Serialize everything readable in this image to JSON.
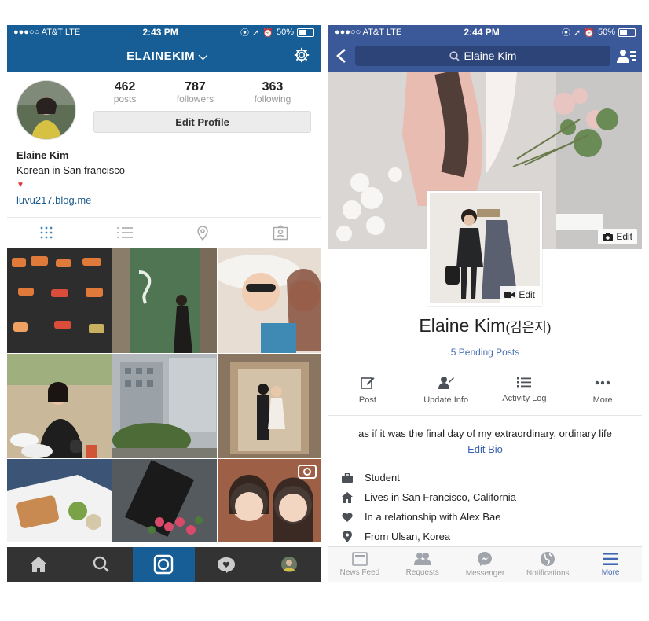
{
  "instagram": {
    "status": {
      "carrier": "●●●○○ AT&T  LTE",
      "time": "2:43 PM",
      "battery": "50%"
    },
    "username": "_ELAINEKIM ⌵",
    "stats": [
      {
        "value": "462",
        "label": "posts"
      },
      {
        "value": "787",
        "label": "followers"
      },
      {
        "value": "363",
        "label": "following"
      }
    ],
    "edit_profile": "Edit Profile",
    "bio": {
      "name": "Elaine Kim",
      "line": "Korean in San francisco",
      "flag": "▼",
      "link": "luvu217.blog.me"
    },
    "tabs": [
      "grid-icon",
      "list-icon",
      "location-pin-icon",
      "tagged-person-icon"
    ],
    "bottom_nav": [
      "home-icon",
      "search-icon",
      "camera-icon",
      "heart-bubble-icon",
      "profile-avatar-icon"
    ],
    "accent": "#175e96"
  },
  "facebook": {
    "status": {
      "carrier": "●●●○○ AT&T  LTE",
      "time": "2:44 PM",
      "battery": "50%"
    },
    "search_text": "Elaine Kim",
    "cover_edit": "Edit",
    "profile_edit": "Edit",
    "name": "Elaine Kim",
    "name_korean": "(김은지)",
    "pending": "5 Pending Posts",
    "actions": [
      {
        "label": "Post",
        "icon": "edit-icon"
      },
      {
        "label": "Update Info",
        "icon": "update-info-icon"
      },
      {
        "label": "Activity Log",
        "icon": "activity-log-icon"
      },
      {
        "label": "More",
        "icon": "more-dots-icon"
      }
    ],
    "bio_text": "as if it was the final day of my extraordinary, ordinary life",
    "edit_bio": "Edit Bio",
    "info": [
      {
        "text": "Student",
        "icon": "briefcase-icon"
      },
      {
        "text": "Lives in San Francisco, California",
        "icon": "house-icon"
      },
      {
        "text": "In a relationship with Alex Bae",
        "icon": "heart-icon"
      },
      {
        "text": "From Ulsan, Korea",
        "icon": "location-icon"
      }
    ],
    "bottom_nav": [
      {
        "label": "News Feed",
        "icon": "news-feed-icon"
      },
      {
        "label": "Requests",
        "icon": "requests-icon"
      },
      {
        "label": "Messenger",
        "icon": "messenger-icon"
      },
      {
        "label": "Notifications",
        "icon": "globe-icon"
      },
      {
        "label": "More",
        "icon": "hamburger-icon"
      }
    ],
    "accent": "#3b5998"
  }
}
